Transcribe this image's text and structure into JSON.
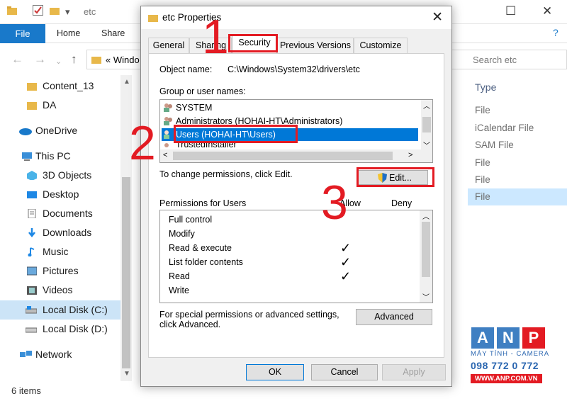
{
  "explorer": {
    "title_path": "etc",
    "ribbon_tabs": [
      "File",
      "Home",
      "Share"
    ],
    "address_fragment": "«  Windo",
    "search_placeholder": "Search etc",
    "column_header": "Type",
    "sidebar": [
      {
        "label": "Content_13",
        "icon": "folder-icon"
      },
      {
        "label": "DA",
        "icon": "folder-icon"
      },
      {
        "label": "OneDrive",
        "icon": "cloud-icon"
      },
      {
        "label": "This PC",
        "icon": "computer-icon"
      },
      {
        "label": "3D Objects",
        "icon": "cube-icon"
      },
      {
        "label": "Desktop",
        "icon": "desktop-icon"
      },
      {
        "label": "Documents",
        "icon": "document-icon"
      },
      {
        "label": "Downloads",
        "icon": "download-icon"
      },
      {
        "label": "Music",
        "icon": "music-icon"
      },
      {
        "label": "Pictures",
        "icon": "pictures-icon"
      },
      {
        "label": "Videos",
        "icon": "video-icon"
      },
      {
        "label": "Local Disk (C:)",
        "icon": "drive-icon",
        "selected": true
      },
      {
        "label": "Local Disk (D:)",
        "icon": "drive-icon"
      },
      {
        "label": "Network",
        "icon": "network-icon"
      }
    ],
    "file_types": [
      "File",
      "iCalendar File",
      "SAM File",
      "File",
      "File",
      "File"
    ],
    "status": "6 items"
  },
  "dialog": {
    "title": "etc Properties",
    "tabs": [
      "General",
      "Sharing",
      "Security",
      "Previous Versions",
      "Customize"
    ],
    "active_tab": "Security",
    "object_name_label": "Object name:",
    "object_name_value": "C:\\Windows\\System32\\drivers\\etc",
    "group_label": "Group or user names:",
    "users": [
      {
        "name": "SYSTEM"
      },
      {
        "name": "Administrators (HOHAI-HT\\Administrators)"
      },
      {
        "name": "Users (HOHAI-HT\\Users)",
        "selected": true
      },
      {
        "name": "TrustedInstaller"
      }
    ],
    "change_text": "To change permissions, click Edit.",
    "edit_button": "Edit...",
    "permissions_label": "Permissions for Users",
    "allow_label": "Allow",
    "deny_label": "Deny",
    "permissions": [
      {
        "name": "Full control",
        "allow": false
      },
      {
        "name": "Modify",
        "allow": false
      },
      {
        "name": "Read & execute",
        "allow": true
      },
      {
        "name": "List folder contents",
        "allow": true
      },
      {
        "name": "Read",
        "allow": true
      },
      {
        "name": "Write",
        "allow": false
      }
    ],
    "special_text_1": "For special permissions or advanced settings,",
    "special_text_2": "click Advanced.",
    "advanced_button": "Advanced",
    "ok_button": "OK",
    "cancel_button": "Cancel",
    "apply_button": "Apply"
  },
  "annotations": {
    "step1": "1",
    "step2": "2",
    "step3": "3",
    "highlight_color": "#e31b23"
  },
  "watermark": {
    "letters": [
      "A",
      "N",
      "P"
    ],
    "tagline": "MÁY TÍNH - CAMERA",
    "phone": "098 772 0 772",
    "url": "WWW.ANP.COM.VN"
  }
}
